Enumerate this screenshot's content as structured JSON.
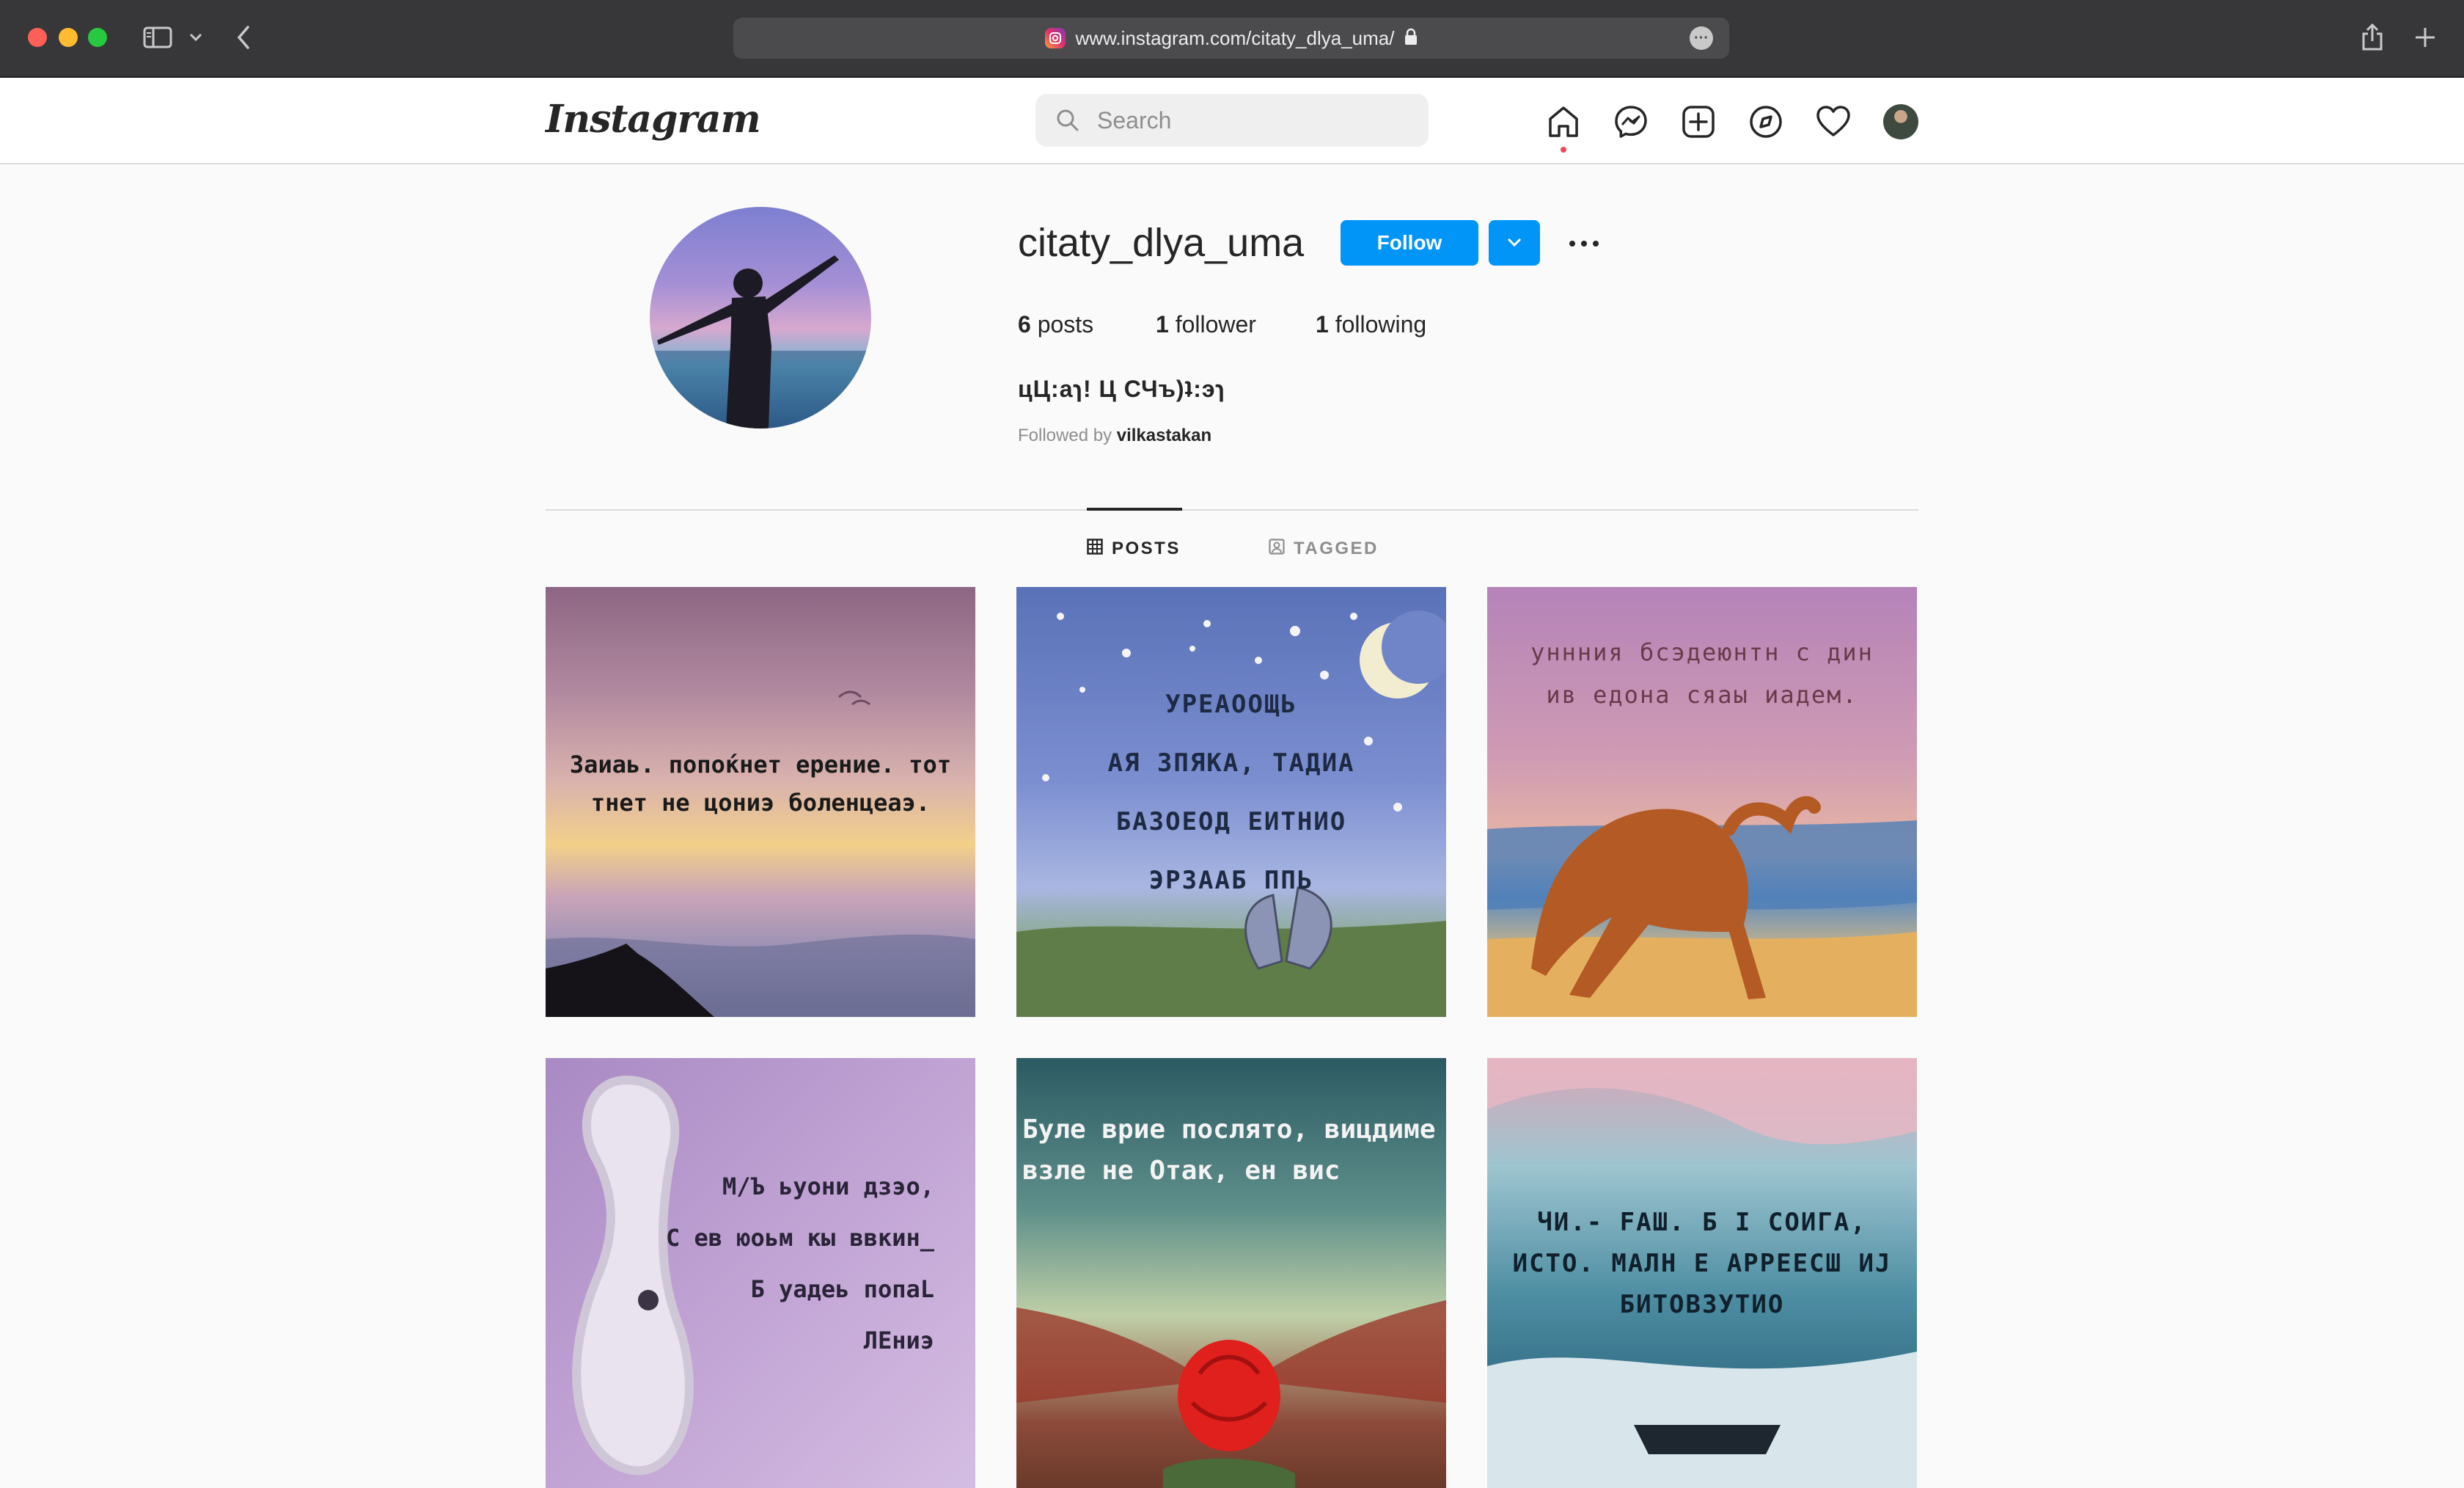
{
  "browser": {
    "url": "www.instagram.com/citaty_dlya_uma/"
  },
  "header": {
    "logo": "Instagram",
    "search_placeholder": "Search"
  },
  "profile": {
    "username": "citaty_dlya_uma",
    "follow_label": "Follow",
    "posts_count": "6",
    "posts_label": " posts",
    "followers_count": "1",
    "followers_label": " follower",
    "following_count": "1",
    "following_label": " following",
    "bio": "цЦ:аɿ! Ц СЧъ)ʇ:эɿ",
    "followed_by_prefix": "Followed by ",
    "followed_by_user": "vilkastakan"
  },
  "tabs": [
    {
      "label": "POSTS",
      "active": true
    },
    {
      "label": "TAGGED",
      "active": false
    }
  ],
  "posts": [
    {
      "caption": "Заиаь. попоќнет ерение. тот\nтнет не цониэ боленцеаэ."
    },
    {
      "caption": "УРЕАООЩЬ\nАЯ ЗПЯКА, ТАДИА\nБАЗОЕОД ЕИТНИО\nЭРЗААБ ППЬ"
    },
    {
      "caption": "уннния бсэдеюнтн с дин\nив едона сяаы иадем."
    },
    {
      "caption": "М/Ъ ьуони дзэо,\nС ев юоьм кы ввкин_\nБ уадеь попаL\nЛЕниэ"
    },
    {
      "caption": "Буле врие послято, вицдиме\nвзле не Отак, ен вис"
    },
    {
      "caption": "ЧИ.- FАШ. Б I СОИГА,\nИСТО. МАЛН Е АРРЕЕСШ ИЈ\nБИТОВЗУТИО"
    }
  ],
  "colors": {
    "accent": "#0095f6",
    "notification": "#ed4956"
  }
}
